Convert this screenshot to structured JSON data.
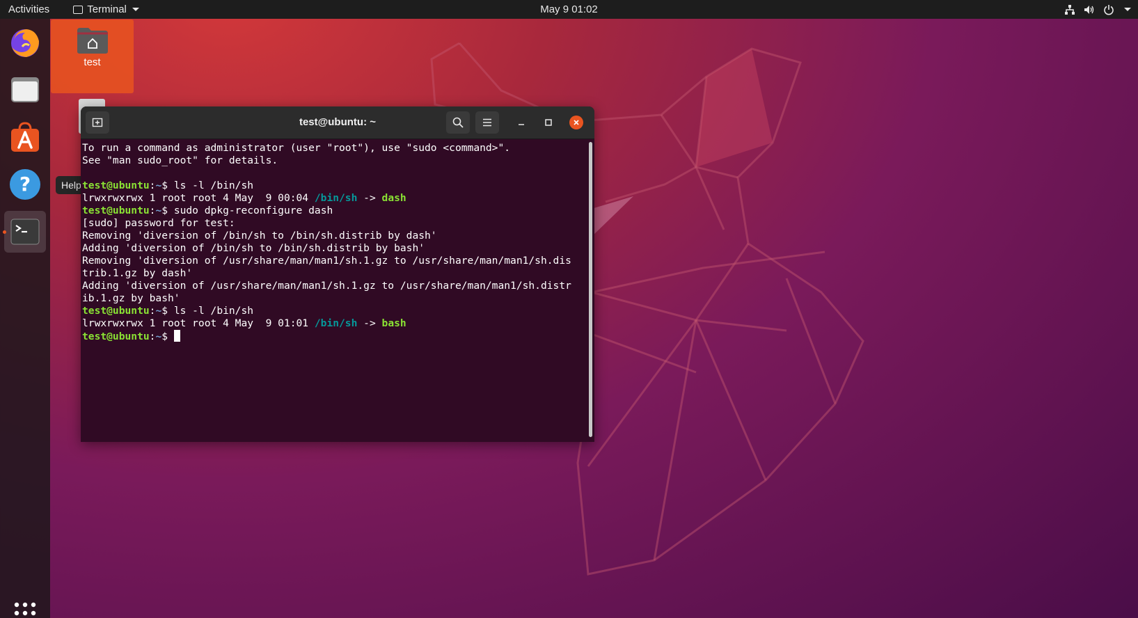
{
  "topbar": {
    "activities": "Activities",
    "app_name": "Terminal",
    "clock": "May 9  01:02",
    "icons": [
      "network-icon",
      "volume-icon",
      "power-icon"
    ]
  },
  "dock": {
    "items": [
      {
        "name": "firefox",
        "icon": "firefox-icon"
      },
      {
        "name": "files",
        "icon": "files-icon"
      },
      {
        "name": "ubuntu-software",
        "icon": "software-icon"
      },
      {
        "name": "help",
        "icon": "help-icon"
      },
      {
        "name": "terminal",
        "icon": "terminal-icon",
        "running": true
      }
    ],
    "tooltip": "Help",
    "show_apps_icon": "app-grid-icon"
  },
  "desktop": {
    "icons": [
      {
        "label": "test",
        "icon": "home-folder-icon"
      }
    ]
  },
  "terminal": {
    "title": "test@ubuntu: ~",
    "lines": [
      [
        {
          "t": "To run a command as administrator (user \"root\"), use \"sudo <command>\"."
        }
      ],
      [
        {
          "t": "See \"man sudo_root\" for details."
        }
      ],
      [
        {
          "t": ""
        }
      ],
      [
        {
          "t": "test@ubuntu",
          "c": "pr-user"
        },
        {
          "t": ":"
        },
        {
          "t": "~",
          "c": "pr-path"
        },
        {
          "t": "$ ls -l /bin/sh"
        }
      ],
      [
        {
          "t": "lrwxrwxrwx 1 root root 4 May  9 00:04 "
        },
        {
          "t": "/bin/sh",
          "c": "ls-dir2"
        },
        {
          "t": " -> "
        },
        {
          "t": "dash",
          "c": "ls-tgt"
        }
      ],
      [
        {
          "t": "test@ubuntu",
          "c": "pr-user"
        },
        {
          "t": ":"
        },
        {
          "t": "~",
          "c": "pr-path"
        },
        {
          "t": "$ sudo dpkg-reconfigure dash"
        }
      ],
      [
        {
          "t": "[sudo] password for test:"
        }
      ],
      [
        {
          "t": "Removing 'diversion of /bin/sh to /bin/sh.distrib by dash'"
        }
      ],
      [
        {
          "t": "Adding 'diversion of /bin/sh to /bin/sh.distrib by bash'"
        }
      ],
      [
        {
          "t": "Removing 'diversion of /usr/share/man/man1/sh.1.gz to /usr/share/man/man1/sh.dis"
        }
      ],
      [
        {
          "t": "trib.1.gz by dash'"
        }
      ],
      [
        {
          "t": "Adding 'diversion of /usr/share/man/man1/sh.1.gz to /usr/share/man/man1/sh.distr"
        }
      ],
      [
        {
          "t": "ib.1.gz by bash'"
        }
      ],
      [
        {
          "t": "test@ubuntu",
          "c": "pr-user"
        },
        {
          "t": ":"
        },
        {
          "t": "~",
          "c": "pr-path"
        },
        {
          "t": "$ ls -l /bin/sh"
        }
      ],
      [
        {
          "t": "lrwxrwxrwx 1 root root 4 May  9 01:01 "
        },
        {
          "t": "/bin/sh",
          "c": "ls-dir2"
        },
        {
          "t": " -> "
        },
        {
          "t": "bash",
          "c": "ls-tgt"
        }
      ],
      [
        {
          "t": "test@ubuntu",
          "c": "pr-user"
        },
        {
          "t": ":"
        },
        {
          "t": "~",
          "c": "pr-path"
        },
        {
          "t": "$ "
        },
        {
          "cursor": true
        }
      ]
    ]
  },
  "colors": {
    "accent": "#e95420",
    "terminal_bg": "#300a24",
    "prompt_user": "#8ae234",
    "prompt_path": "#729fcf",
    "symlink": "#06989a"
  }
}
